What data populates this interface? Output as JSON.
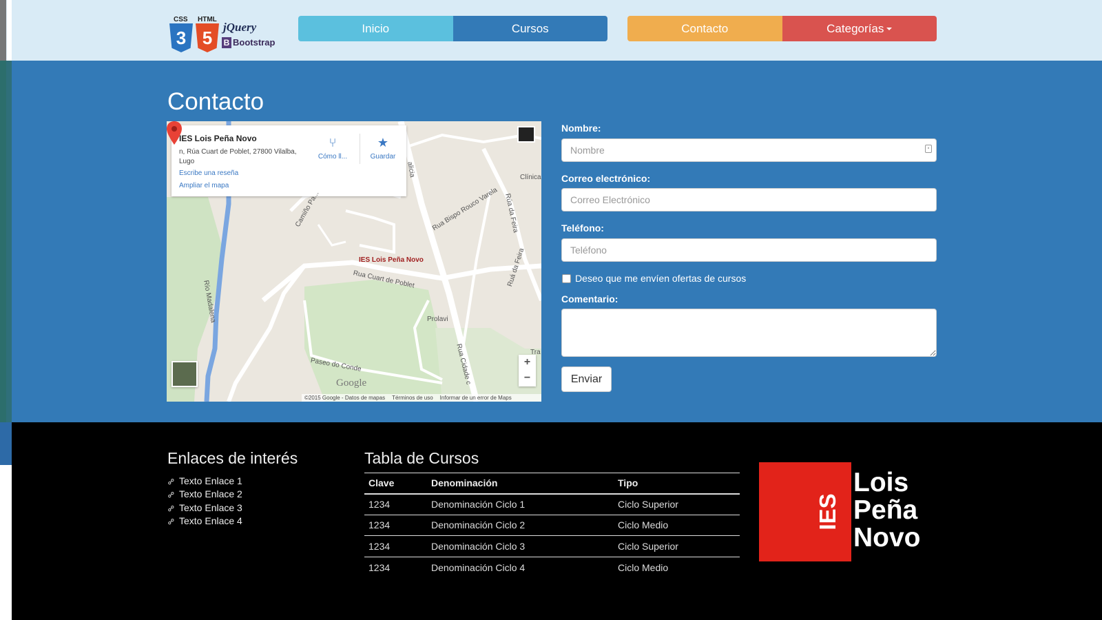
{
  "logo": {
    "css": "CSS",
    "html": "HTML",
    "css_num": "3",
    "html_num": "5",
    "jquery": "jQuery",
    "bootstrap_letter": "B",
    "bootstrap": "Bootstrap"
  },
  "nav": {
    "inicio": "Inicio",
    "cursos": "Cursos",
    "contacto": "Contacto",
    "categorias": "Categorías"
  },
  "colors": {
    "header_bg": "#d9ebf6",
    "main_bg": "#337ab7",
    "inicio": "#5bc0de",
    "cursos": "#337ab7",
    "contacto": "#f0ad4e",
    "categorias": "#d9534f",
    "footer_bg": "#000000",
    "ies_red": "#e2231a"
  },
  "page_title": "Contacto",
  "map": {
    "place_name": "IES Lois Peña Novo",
    "address": "n, Rúa Cuart de Poblet, 27800 Vilalba, Lugo",
    "review_link": "Escribe una reseña",
    "enlarge_link": "Ampliar el mapa",
    "directions": "Cómo ll...",
    "save": "Guardar",
    "pin_label": "IES Lois Peña Novo",
    "labels": [
      "Río Madalena",
      "Camiño Pa...",
      "Rua Bispo Rouco Varela",
      "Rua Cuart de Poblet",
      "Rúa da Feira",
      "Ruá da Feira",
      "Clínica San",
      "Prolavi",
      "Paseo do Conde",
      "Rua Cidade c",
      "Tra",
      "alicia"
    ],
    "google": "Google",
    "footer": [
      "©2015 Google - Datos de mapas",
      "Términos de uso",
      "Informar de un error de Maps"
    ]
  },
  "form": {
    "name_label": "Nombre:",
    "name_placeholder": "Nombre",
    "email_label": "Correo electrónico:",
    "email_placeholder": "Correo Electrónico",
    "phone_label": "Teléfono:",
    "phone_placeholder": "Teléfono",
    "offers_label": "Deseo que me envíen ofertas de cursos",
    "comment_label": "Comentario:",
    "submit": "Enviar"
  },
  "footer": {
    "links_title": "Enlaces de interés",
    "links": [
      "Texto Enlace 1",
      "Texto Enlace 2",
      "Texto Enlace 3",
      "Texto Enlace 4"
    ],
    "table_title": "Tabla de Cursos",
    "table_headers": [
      "Clave",
      "Denominación",
      "Tipo"
    ],
    "table_rows": [
      [
        "1234",
        "Denominación Ciclo 1",
        "Ciclo Superior"
      ],
      [
        "1234",
        "Denominación Ciclo 2",
        "Ciclo Medio"
      ],
      [
        "1234",
        "Denominación Ciclo 3",
        "Ciclo Superior"
      ],
      [
        "1234",
        "Denominación Ciclo 4",
        "Ciclo Medio"
      ]
    ],
    "logo_ies": "IES",
    "logo_name": [
      "Lois",
      "Peña",
      "Novo"
    ]
  }
}
